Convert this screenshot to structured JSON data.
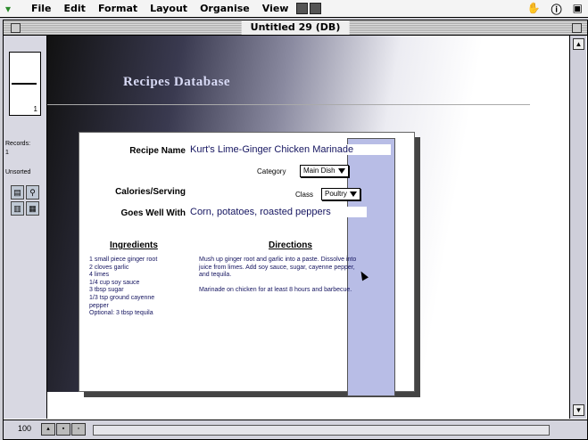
{
  "menubar": {
    "items": [
      "File",
      "Edit",
      "Format",
      "Layout",
      "Organise",
      "View"
    ]
  },
  "window": {
    "title": "Untitled 29 (DB)"
  },
  "status": {
    "page_num": "1",
    "records_label": "Records:",
    "records_count": "1",
    "unsorted_label": "Unsorted"
  },
  "layout": {
    "header": "Recipes Database"
  },
  "record": {
    "recipe_name_label": "Recipe Name",
    "recipe_name": "Kurt's Lime-Ginger Chicken Marinade",
    "category_label": "Category",
    "category_value": "Main Dish",
    "calories_label": "Calories/Serving",
    "calories_value": "",
    "class_label": "Class",
    "class_value": "Poultry",
    "goes_with_label": "Goes Well With",
    "goes_with_value": "Corn, potatoes, roasted peppers",
    "ingredients_label": "Ingredients",
    "ingredients": [
      "1 small piece ginger root",
      "2 cloves garlic",
      "4 limes",
      "1/4 cup soy sauce",
      "3 tbsp sugar",
      "1/3 tsp ground cayenne",
      "   pepper",
      "Optional: 3 tbsp tequila"
    ],
    "directions_label": "Directions",
    "directions": [
      "Mush up ginger root and garlic into a paste. Dissolve into juice from limes. Add soy sauce, sugar, cayenne pepper, and tequila.",
      "Marinade on chicken for at least 8 hours and barbecue."
    ]
  },
  "bottom": {
    "zoom": "100"
  }
}
